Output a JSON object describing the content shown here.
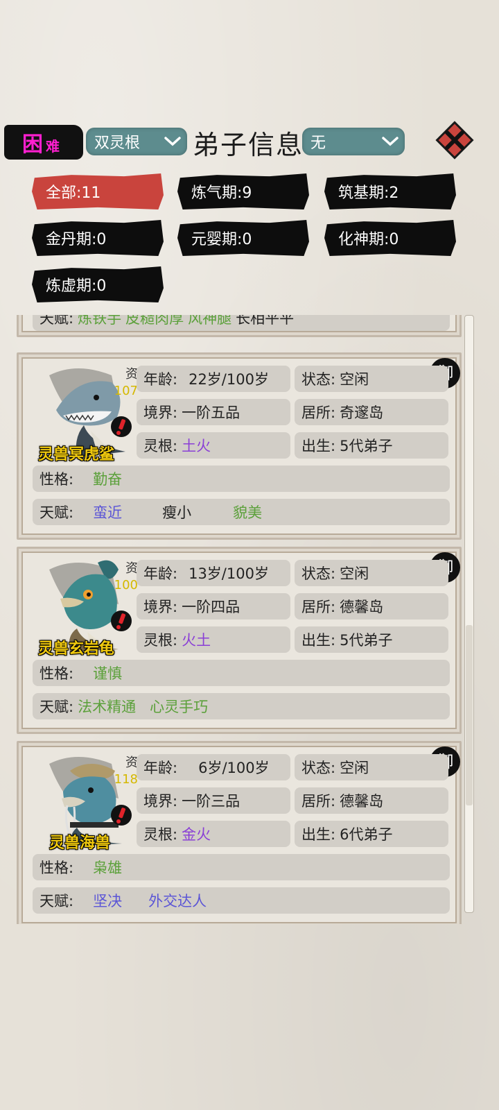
{
  "header": {
    "difficulty_big": "困",
    "difficulty_small": "难",
    "root_filter": "双灵根",
    "title": "弟子信息",
    "status_filter": "无"
  },
  "filters": [
    {
      "label": "全部",
      "count": "11",
      "text": "全部:11",
      "active": true
    },
    {
      "label": "炼气期",
      "text": "炼气期:9"
    },
    {
      "label": "筑基期",
      "text": "筑基期:2"
    },
    {
      "label": "金丹期",
      "text": "金丹期:0"
    },
    {
      "label": "元婴期",
      "text": "元婴期:0"
    },
    {
      "label": "化神期",
      "text": "化神期:0"
    },
    {
      "label": "炼虚期",
      "text": "炼虚期:0"
    }
  ],
  "partial_card": {
    "talent_label": "天赋:",
    "talents": [
      "炼铁手",
      "皮糙肉厚",
      "风神腿",
      "长相平平"
    ]
  },
  "labels": {
    "aptitude": "资",
    "age": "年龄:",
    "status": "状态:",
    "realm": "境界:",
    "residence": "居所:",
    "root": "灵根:",
    "birth": "出生:",
    "personality": "性格:",
    "talent": "天赋:",
    "release": "御"
  },
  "disciples": [
    {
      "name": "灵兽冥虎鲨",
      "aptitude": "107",
      "age": "22岁/100岁",
      "status": "空闲",
      "realm": "一阶五品",
      "residence": "奇邃岛",
      "root": "土火",
      "birth": "5代弟子",
      "personality": "勤奋",
      "talents": [
        "蛮近",
        "瘦小",
        "貌美"
      ]
    },
    {
      "name": "灵兽玄岩龟",
      "aptitude": "100",
      "age": "13岁/100岁",
      "status": "空闲",
      "realm": "一阶四品",
      "residence": "德馨岛",
      "root": "火土",
      "birth": "5代弟子",
      "personality": "谨慎",
      "talents": [
        "法术精通",
        "心灵手巧"
      ]
    },
    {
      "name": "灵兽海兽",
      "aptitude": "118",
      "age": "6岁/100岁",
      "status": "空闲",
      "realm": "一阶三品",
      "residence": "德馨岛",
      "root": "金火",
      "birth": "6代弟子",
      "personality": "枭雄",
      "talents": [
        "坚决",
        "外交达人"
      ]
    }
  ]
}
